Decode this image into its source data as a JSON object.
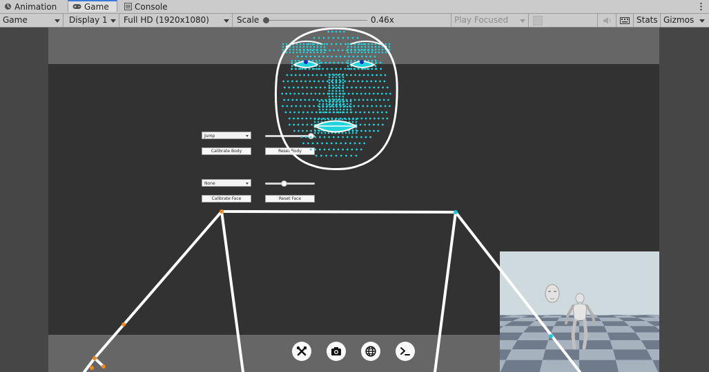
{
  "tabs": [
    {
      "label": "Animation",
      "icon": "animation-icon",
      "active": false
    },
    {
      "label": "Game",
      "icon": "gamepad-icon",
      "active": true
    },
    {
      "label": "Console",
      "icon": "console-list-icon",
      "active": false
    }
  ],
  "toolbar": {
    "view_mode": "Game",
    "display": "Display 1",
    "resolution": "Full HD (1920x1080)",
    "scale_label": "Scale",
    "scale_value": "0.46x",
    "play_mode": "Play Focused",
    "stats_label": "Stats",
    "gizmos_label": "Gizmos"
  },
  "panel": {
    "body_dropdown": "Jump",
    "calibrate_body": "Calibrate Body",
    "reset_body": "Reset Body",
    "face_dropdown": "None",
    "calibrate_face": "Calibrate Face",
    "reset_face": "Reset Face",
    "body_slider_fraction": 0.95,
    "face_slider_fraction": 0.35
  },
  "bottom_buttons": [
    {
      "name": "tools-button",
      "icon": "wrench-screwdriver-icon"
    },
    {
      "name": "camera-button",
      "icon": "camera-icon"
    },
    {
      "name": "globe-button",
      "icon": "globe-icon"
    },
    {
      "name": "terminal-button",
      "icon": "terminal-icon"
    }
  ],
  "colors": {
    "landmark": "#22d3dc",
    "skeleton": "#ffffff",
    "joint_left": "#f08a1c",
    "joint_right": "#1cc8d8",
    "tab_accent": "#3a79d9"
  }
}
